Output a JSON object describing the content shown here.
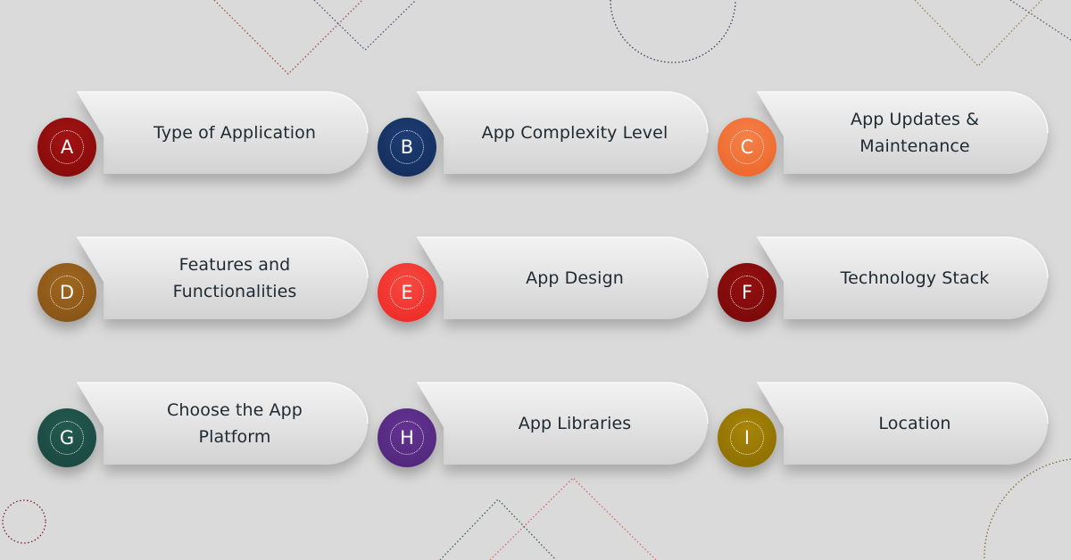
{
  "items": [
    {
      "letter": "A",
      "label_lines": [
        "Type of Application"
      ],
      "color": "#8a0b0b",
      "color_light": "#a11414"
    },
    {
      "letter": "B",
      "label_lines": [
        "App Complexity Level"
      ],
      "color": "#15305f",
      "color_light": "#1d3d73"
    },
    {
      "letter": "C",
      "label_lines": [
        "App Updates &",
        "Maintenance"
      ],
      "color": "#ee6a2e",
      "color_light": "#f4814a"
    },
    {
      "letter": "D",
      "label_lines": [
        "Features and",
        "Functionalities"
      ],
      "color": "#8a5618",
      "color_light": "#a0661f"
    },
    {
      "letter": "E",
      "label_lines": [
        "App Design"
      ],
      "color": "#ef2e2a",
      "color_light": "#f64a40"
    },
    {
      "letter": "F",
      "label_lines": [
        "Technology Stack"
      ],
      "color": "#7c0a0a",
      "color_light": "#950f10"
    },
    {
      "letter": "G",
      "label_lines": [
        "Choose the App",
        "Platform"
      ],
      "color": "#1b4a42",
      "color_light": "#235a50"
    },
    {
      "letter": "H",
      "label_lines": [
        "App Libraries"
      ],
      "color": "#53297e",
      "color_light": "#633392"
    },
    {
      "letter": "I",
      "label_lines": [
        "Location"
      ],
      "color": "#8f7100",
      "color_light": "#a8860a"
    }
  ]
}
